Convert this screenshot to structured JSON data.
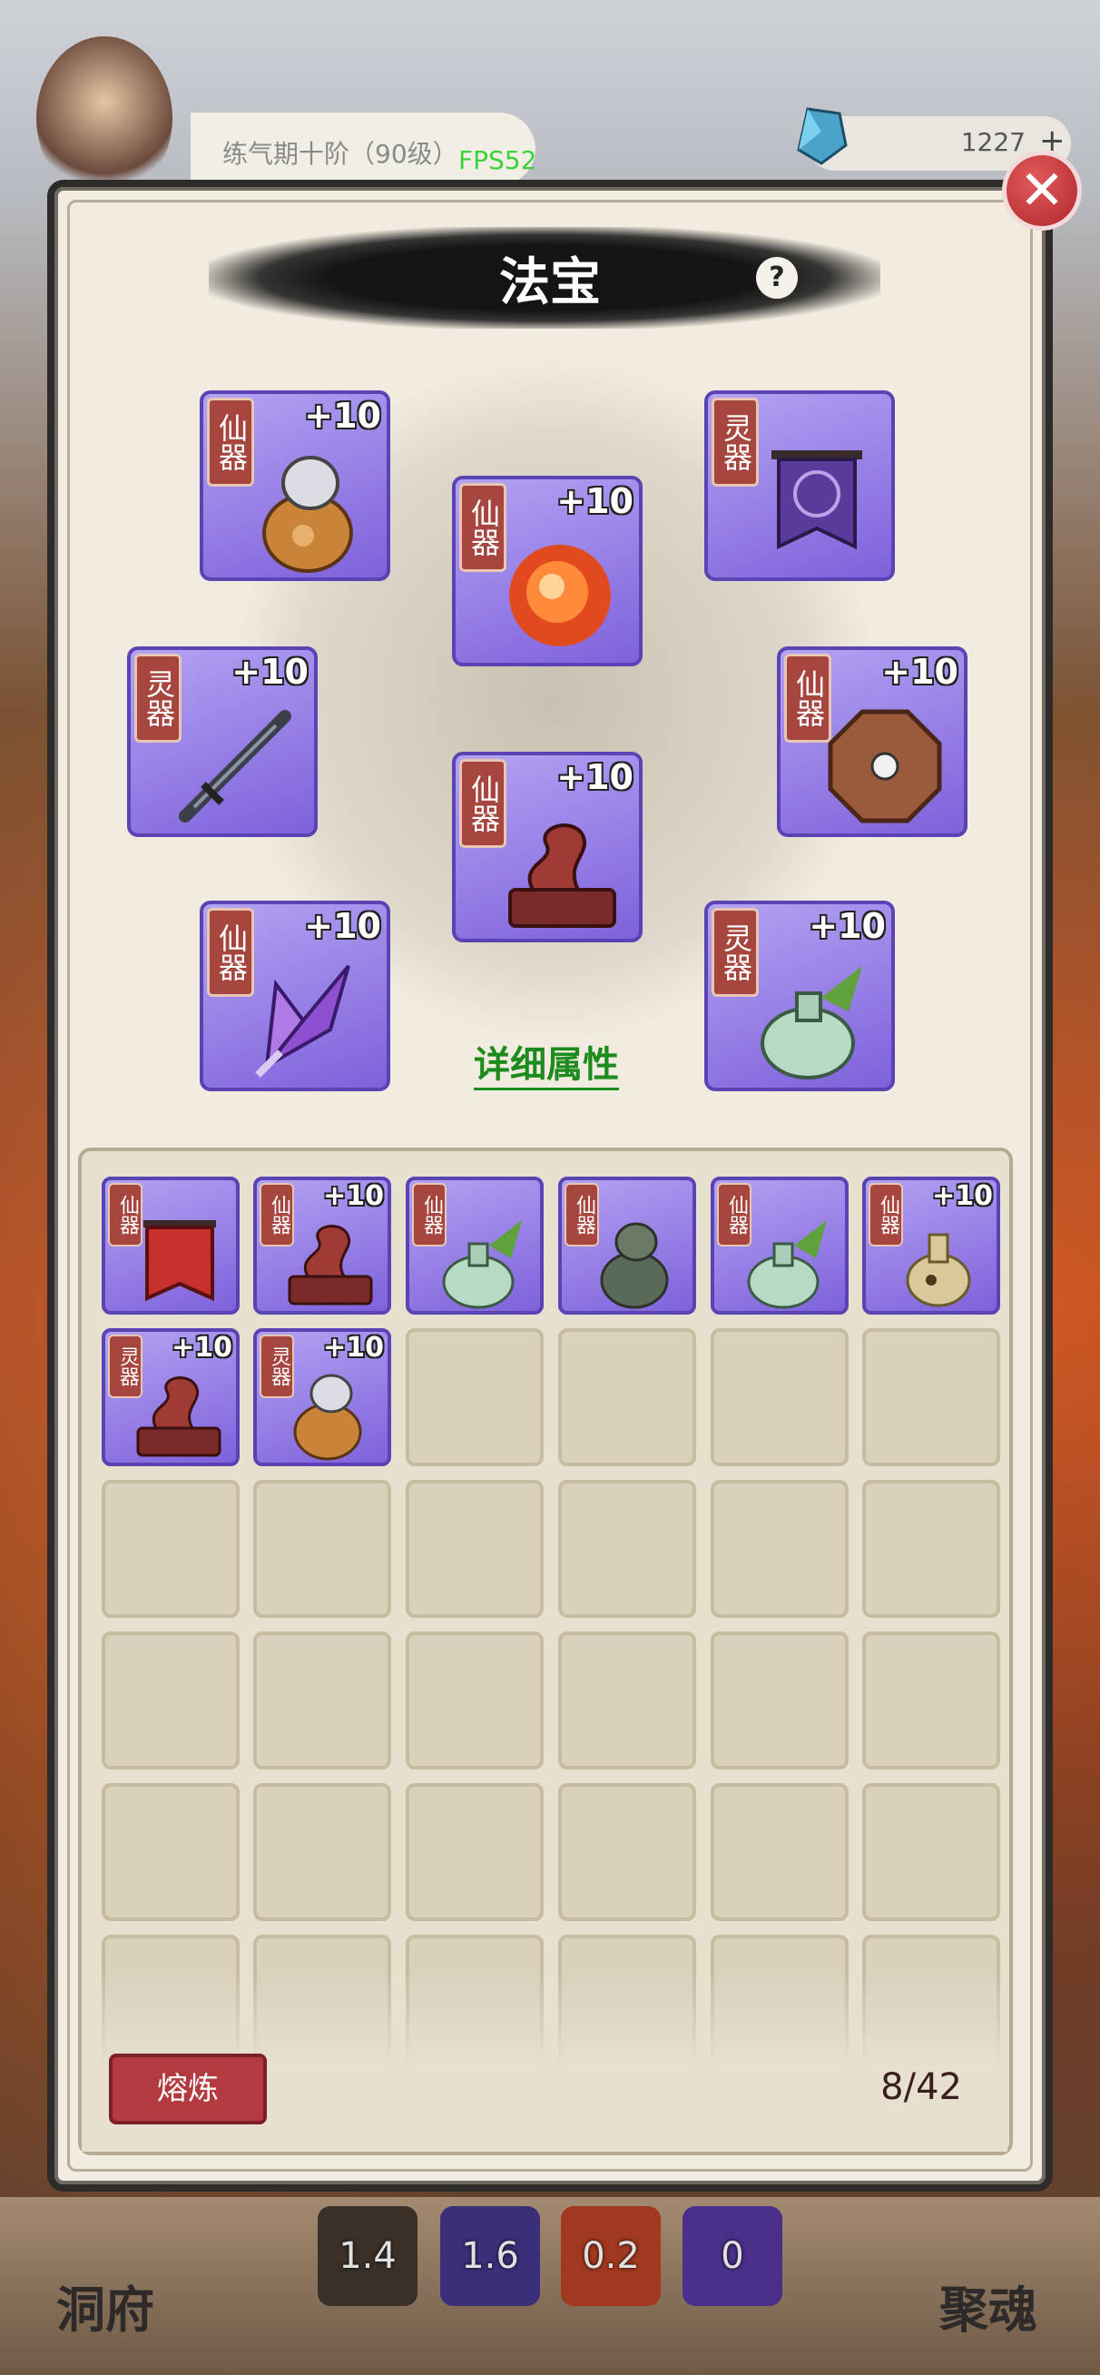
{
  "hud": {
    "rank": "练气期十阶（90级）",
    "fps": "FPS52",
    "crystal_count": "1227",
    "crystal_plus": "+"
  },
  "bottom": {
    "left_label": "洞府",
    "right_label": "聚魂",
    "skills": [
      "1.4",
      "1.6",
      "0.2",
      "0"
    ]
  },
  "modal": {
    "title": "法宝",
    "help": "?",
    "close": "✕",
    "detail_link": "详细属性",
    "equipped": [
      {
        "grade": "仙器",
        "level": "+10",
        "icon": "gourd-icon"
      },
      {
        "grade": "仙器",
        "level": "+10",
        "icon": "fire-orb-icon"
      },
      {
        "grade": "灵器",
        "level": "",
        "icon": "banner-icon"
      },
      {
        "grade": "灵器",
        "level": "+10",
        "icon": "sword-icon"
      },
      {
        "grade": "仙器",
        "level": "+10",
        "icon": "bagua-mirror-icon"
      },
      {
        "grade": "仙器",
        "level": "+10",
        "icon": "serpent-seal-icon"
      },
      {
        "grade": "仙器",
        "level": "+10",
        "icon": "feather-fan-icon"
      },
      {
        "grade": "灵器",
        "level": "+10",
        "icon": "jade-vase-icon"
      }
    ],
    "inventory": [
      {
        "grade": "仙器",
        "level": "",
        "icon": "red-banner-icon"
      },
      {
        "grade": "仙器",
        "level": "+10",
        "icon": "serpent-seal-icon"
      },
      {
        "grade": "仙器",
        "level": "",
        "icon": "jade-vase-icon"
      },
      {
        "grade": "仙器",
        "level": "",
        "icon": "dark-gourd-icon"
      },
      {
        "grade": "仙器",
        "level": "",
        "icon": "jade-vase-icon"
      },
      {
        "grade": "仙器",
        "level": "+10",
        "icon": "golden-bottle-icon"
      },
      {
        "grade": "灵器",
        "level": "+10",
        "icon": "serpent-seal-icon"
      },
      {
        "grade": "灵器",
        "level": "+10",
        "icon": "gourd-icon"
      }
    ],
    "smelt_button": "熔炼",
    "capacity": "8/42"
  },
  "colors": {
    "slot_purple": "#8b6fe0",
    "grade_red": "#a7463f",
    "link_green": "#1d8b1d",
    "close_red": "#c0353a"
  }
}
